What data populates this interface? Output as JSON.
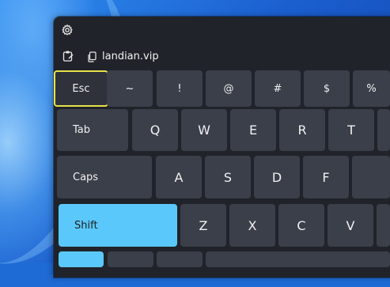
{
  "keyboard": {
    "source_text": "landian.vip",
    "row1": [
      "Esc",
      "~",
      "!",
      "@",
      "#",
      "$",
      "%"
    ],
    "row2": [
      "Tab",
      "Q",
      "W",
      "E",
      "R",
      "T"
    ],
    "row3": [
      "Caps",
      "A",
      "S",
      "D",
      "F"
    ],
    "row4": [
      "Shift",
      "Z",
      "X",
      "C",
      "V"
    ]
  },
  "icons": {
    "settings": "gear-icon",
    "clipboard": "clipboard-icon",
    "copy": "copy-icon"
  },
  "colors": {
    "window_bg": "#20232a",
    "key_bg": "#3b3f4a",
    "focus_outline": "#e6e24a",
    "shift_active": "#5ac8fa"
  }
}
